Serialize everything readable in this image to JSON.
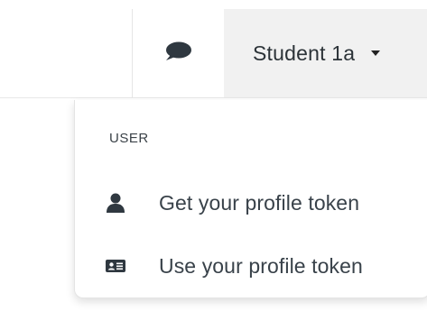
{
  "navbar": {
    "chat_icon": "comment-icon",
    "user_name": "Student 1a",
    "caret_icon": "caret-down-icon"
  },
  "dropdown": {
    "header": "USER",
    "items": [
      {
        "icon": "user-icon",
        "label": "Get your profile token"
      },
      {
        "icon": "id-card-icon",
        "label": "Use your profile token"
      }
    ]
  },
  "colors": {
    "toggle_background": "#f1f1f1",
    "icon_color": "#2f3840",
    "text_color": "#39424a"
  }
}
